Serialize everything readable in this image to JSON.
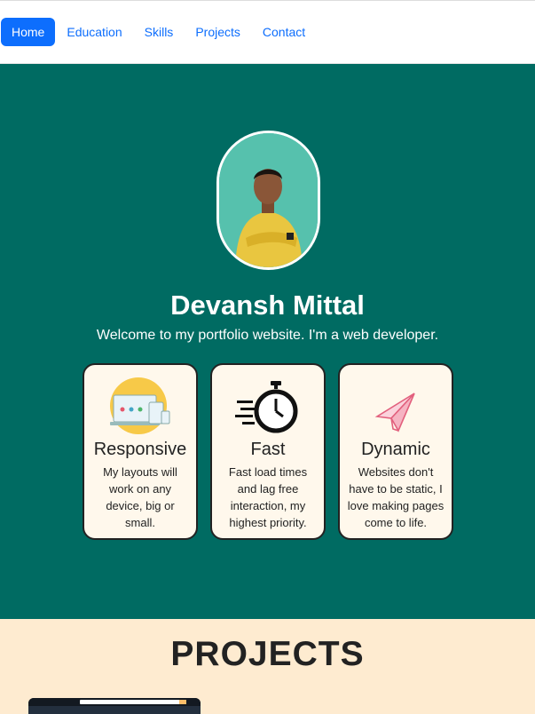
{
  "nav": {
    "items": [
      {
        "label": "Home",
        "active": true
      },
      {
        "label": "Education"
      },
      {
        "label": "Skills"
      },
      {
        "label": "Projects"
      },
      {
        "label": "Contact"
      }
    ]
  },
  "hero": {
    "name": "Devansh Mittal",
    "tagline": "Welcome to my portfolio website. I'm a web developer.",
    "avatar_icon": "profile-photo"
  },
  "features": [
    {
      "icon": "devices-icon",
      "title": "Responsive",
      "desc": "My layouts will work on any device, big or small."
    },
    {
      "icon": "stopwatch-icon",
      "title": "Fast",
      "desc": "Fast load times and lag free interaction, my highest priority."
    },
    {
      "icon": "paper-plane-icon",
      "title": "Dynamic",
      "desc": "Websites don't have to be static, I love making pages come to life."
    }
  ],
  "projects": {
    "title": "PROJECTS"
  },
  "colors": {
    "hero_bg": "#006b62",
    "card_bg": "#fff8ec",
    "projects_bg": "#feebd0",
    "accent": "#0d6efd"
  }
}
